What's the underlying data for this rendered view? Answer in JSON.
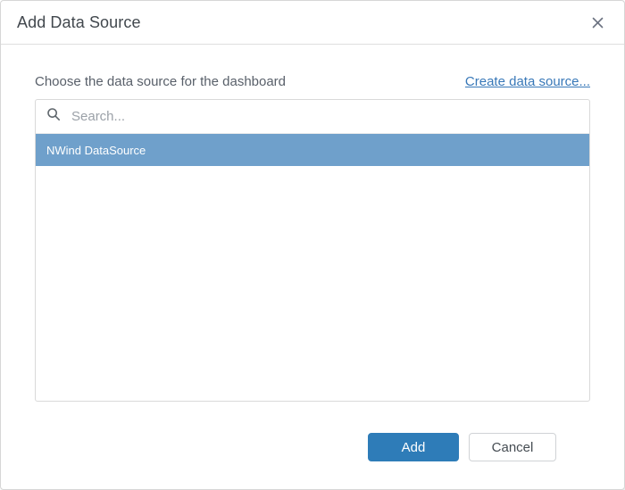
{
  "colors": {
    "accent_blue": "#2e7cb8",
    "selection_blue": "#6fa0cb",
    "link_blue": "#3878b8"
  },
  "dialog": {
    "title": "Add Data Source"
  },
  "body": {
    "prompt": "Choose the data source for the dashboard",
    "create_link_label": "Create data source...",
    "search_placeholder": "Search...",
    "list_items": [
      {
        "label": "NWind DataSource",
        "selected": true
      }
    ]
  },
  "footer": {
    "add_label": "Add",
    "cancel_label": "Cancel"
  }
}
